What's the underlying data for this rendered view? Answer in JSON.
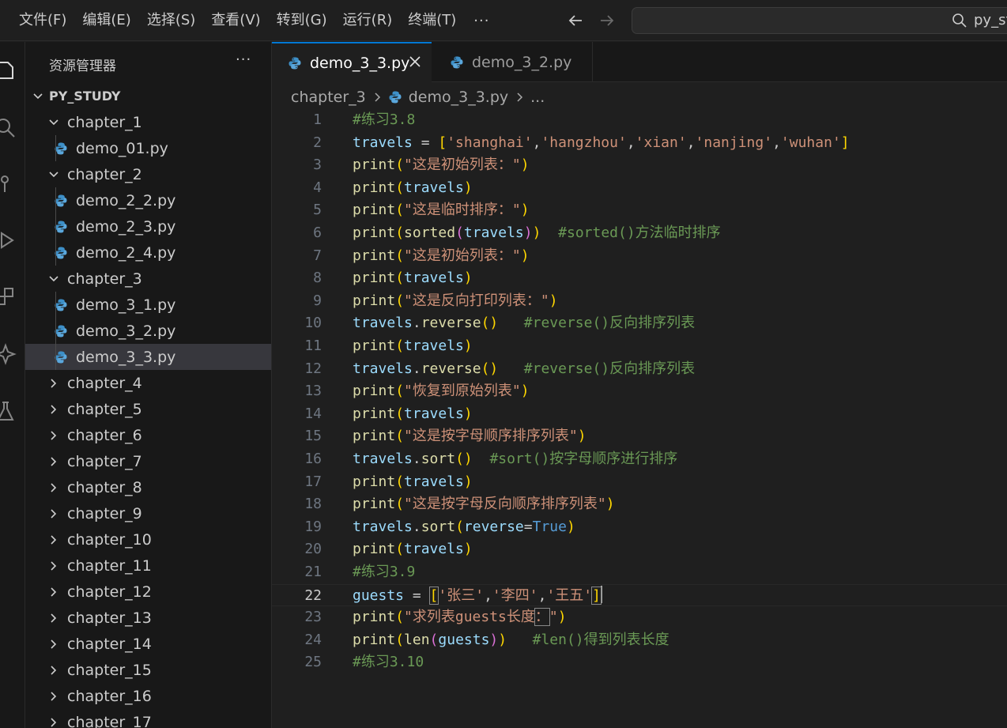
{
  "menu": [
    "文件(F)",
    "编辑(E)",
    "选择(S)",
    "查看(V)",
    "转到(G)",
    "运行(R)",
    "终端(T)",
    "···"
  ],
  "search": {
    "text": "py_study"
  },
  "explorer": {
    "title": "资源管理器",
    "more": "···",
    "root": "PY_STUDY",
    "tree": [
      {
        "label": "chapter_1",
        "type": "folder",
        "expanded": true
      },
      {
        "label": "demo_01.py",
        "type": "file"
      },
      {
        "label": "chapter_2",
        "type": "folder",
        "expanded": true
      },
      {
        "label": "demo_2_2.py",
        "type": "file"
      },
      {
        "label": "demo_2_3.py",
        "type": "file"
      },
      {
        "label": "demo_2_4.py",
        "type": "file"
      },
      {
        "label": "chapter_3",
        "type": "folder",
        "expanded": true
      },
      {
        "label": "demo_3_1.py",
        "type": "file"
      },
      {
        "label": "demo_3_2.py",
        "type": "file"
      },
      {
        "label": "demo_3_3.py",
        "type": "file",
        "selected": true
      },
      {
        "label": "chapter_4",
        "type": "folder",
        "expanded": false
      },
      {
        "label": "chapter_5",
        "type": "folder",
        "expanded": false
      },
      {
        "label": "chapter_6",
        "type": "folder",
        "expanded": false
      },
      {
        "label": "chapter_7",
        "type": "folder",
        "expanded": false
      },
      {
        "label": "chapter_8",
        "type": "folder",
        "expanded": false
      },
      {
        "label": "chapter_9",
        "type": "folder",
        "expanded": false
      },
      {
        "label": "chapter_10",
        "type": "folder",
        "expanded": false
      },
      {
        "label": "chapter_11",
        "type": "folder",
        "expanded": false
      },
      {
        "label": "chapter_12",
        "type": "folder",
        "expanded": false
      },
      {
        "label": "chapter_13",
        "type": "folder",
        "expanded": false
      },
      {
        "label": "chapter_14",
        "type": "folder",
        "expanded": false
      },
      {
        "label": "chapter_15",
        "type": "folder",
        "expanded": false
      },
      {
        "label": "chapter_16",
        "type": "folder",
        "expanded": false
      },
      {
        "label": "chapter_17",
        "type": "folder",
        "expanded": false
      }
    ]
  },
  "tabs": [
    {
      "label": "demo_3_3.py",
      "active": true
    },
    {
      "label": "demo_3_2.py",
      "active": false
    }
  ],
  "breadcrumb": {
    "folder": "chapter_3",
    "file": "demo_3_3.py",
    "more": "..."
  },
  "editor": {
    "current_line": 22,
    "lines": [
      [
        [
          "c",
          "#练习3.8"
        ]
      ],
      [
        [
          "v",
          "travels"
        ],
        [
          "p",
          " = "
        ],
        [
          "b1",
          "["
        ],
        [
          "s",
          "'shanghai'"
        ],
        [
          "p",
          ","
        ],
        [
          "s",
          "'hangzhou'"
        ],
        [
          "p",
          ","
        ],
        [
          "s",
          "'xian'"
        ],
        [
          "p",
          ","
        ],
        [
          "s",
          "'nanjing'"
        ],
        [
          "p",
          ","
        ],
        [
          "s",
          "'wuhan'"
        ],
        [
          "b1",
          "]"
        ]
      ],
      [
        [
          "f",
          "print"
        ],
        [
          "b1",
          "("
        ],
        [
          "s",
          "\"这是初始列表：\""
        ],
        [
          "b1",
          ")"
        ]
      ],
      [
        [
          "f",
          "print"
        ],
        [
          "b1",
          "("
        ],
        [
          "v",
          "travels"
        ],
        [
          "b1",
          ")"
        ]
      ],
      [
        [
          "f",
          "print"
        ],
        [
          "b1",
          "("
        ],
        [
          "s",
          "\"这是临时排序：\""
        ],
        [
          "b1",
          ")"
        ]
      ],
      [
        [
          "f",
          "print"
        ],
        [
          "b1",
          "("
        ],
        [
          "f",
          "sorted"
        ],
        [
          "b2",
          "("
        ],
        [
          "v",
          "travels"
        ],
        [
          "b2",
          ")"
        ],
        [
          "b1",
          ")"
        ],
        [
          "p",
          "  "
        ],
        [
          "c",
          "#sorted()方法临时排序"
        ]
      ],
      [
        [
          "f",
          "print"
        ],
        [
          "b1",
          "("
        ],
        [
          "s",
          "\"这是初始列表：\""
        ],
        [
          "b1",
          ")"
        ]
      ],
      [
        [
          "f",
          "print"
        ],
        [
          "b1",
          "("
        ],
        [
          "v",
          "travels"
        ],
        [
          "b1",
          ")"
        ]
      ],
      [
        [
          "f",
          "print"
        ],
        [
          "b1",
          "("
        ],
        [
          "s",
          "\"这是反向打印列表：\""
        ],
        [
          "b1",
          ")"
        ]
      ],
      [
        [
          "v",
          "travels"
        ],
        [
          "p",
          "."
        ],
        [
          "f",
          "reverse"
        ],
        [
          "b1",
          "()"
        ],
        [
          "p",
          "   "
        ],
        [
          "c",
          "#reverse()反向排序列表"
        ]
      ],
      [
        [
          "f",
          "print"
        ],
        [
          "b1",
          "("
        ],
        [
          "v",
          "travels"
        ],
        [
          "b1",
          ")"
        ]
      ],
      [
        [
          "v",
          "travels"
        ],
        [
          "p",
          "."
        ],
        [
          "f",
          "reverse"
        ],
        [
          "b1",
          "()"
        ],
        [
          "p",
          "   "
        ],
        [
          "c",
          "#reverse()反向排序列表"
        ]
      ],
      [
        [
          "f",
          "print"
        ],
        [
          "b1",
          "("
        ],
        [
          "s",
          "\"恢复到原始列表\""
        ],
        [
          "b1",
          ")"
        ]
      ],
      [
        [
          "f",
          "print"
        ],
        [
          "b1",
          "("
        ],
        [
          "v",
          "travels"
        ],
        [
          "b1",
          ")"
        ]
      ],
      [
        [
          "f",
          "print"
        ],
        [
          "b1",
          "("
        ],
        [
          "s",
          "\"这是按字母顺序排序列表\""
        ],
        [
          "b1",
          ")"
        ]
      ],
      [
        [
          "v",
          "travels"
        ],
        [
          "p",
          "."
        ],
        [
          "f",
          "sort"
        ],
        [
          "b1",
          "()"
        ],
        [
          "p",
          "  "
        ],
        [
          "c",
          "#sort()按字母顺序进行排序"
        ]
      ],
      [
        [
          "f",
          "print"
        ],
        [
          "b1",
          "("
        ],
        [
          "v",
          "travels"
        ],
        [
          "b1",
          ")"
        ]
      ],
      [
        [
          "f",
          "print"
        ],
        [
          "b1",
          "("
        ],
        [
          "s",
          "\"这是按字母反向顺序排序列表\""
        ],
        [
          "b1",
          ")"
        ]
      ],
      [
        [
          "v",
          "travels"
        ],
        [
          "p",
          "."
        ],
        [
          "f",
          "sort"
        ],
        [
          "b1",
          "("
        ],
        [
          "v",
          "reverse"
        ],
        [
          "p",
          "="
        ],
        [
          "k",
          "True"
        ],
        [
          "b1",
          ")"
        ]
      ],
      [
        [
          "f",
          "print"
        ],
        [
          "b1",
          "("
        ],
        [
          "v",
          "travels"
        ],
        [
          "b1",
          ")"
        ]
      ],
      [
        [
          "c",
          "#练习3.9"
        ]
      ],
      [
        [
          "v",
          "guests"
        ],
        [
          "p",
          " = "
        ],
        [
          "b1m",
          "["
        ],
        [
          "s",
          "'张三'"
        ],
        [
          "p",
          ","
        ],
        [
          "s",
          "'李四'"
        ],
        [
          "p",
          ","
        ],
        [
          "s",
          "'王五'"
        ],
        [
          "b1m",
          "]"
        ],
        [
          "cursor",
          ""
        ]
      ],
      [
        [
          "f",
          "print"
        ],
        [
          "b1",
          "("
        ],
        [
          "s",
          "\"求列表guests长度"
        ],
        [
          "sm",
          "："
        ],
        [
          "s",
          "\""
        ],
        [
          "b1",
          ")"
        ]
      ],
      [
        [
          "f",
          "print"
        ],
        [
          "b1",
          "("
        ],
        [
          "f",
          "len"
        ],
        [
          "b2",
          "("
        ],
        [
          "v",
          "guests"
        ],
        [
          "b2",
          ")"
        ],
        [
          "b1",
          ")"
        ],
        [
          "p",
          "   "
        ],
        [
          "c",
          "#len()得到列表长度"
        ]
      ],
      [
        [
          "c",
          "#练习3.10"
        ]
      ]
    ]
  },
  "colors": {
    "accent": "#0078d4",
    "background": "#1f1f1f",
    "sidebar": "#181818",
    "selection": "#37373d",
    "python_icon": "#3d8fc7"
  }
}
